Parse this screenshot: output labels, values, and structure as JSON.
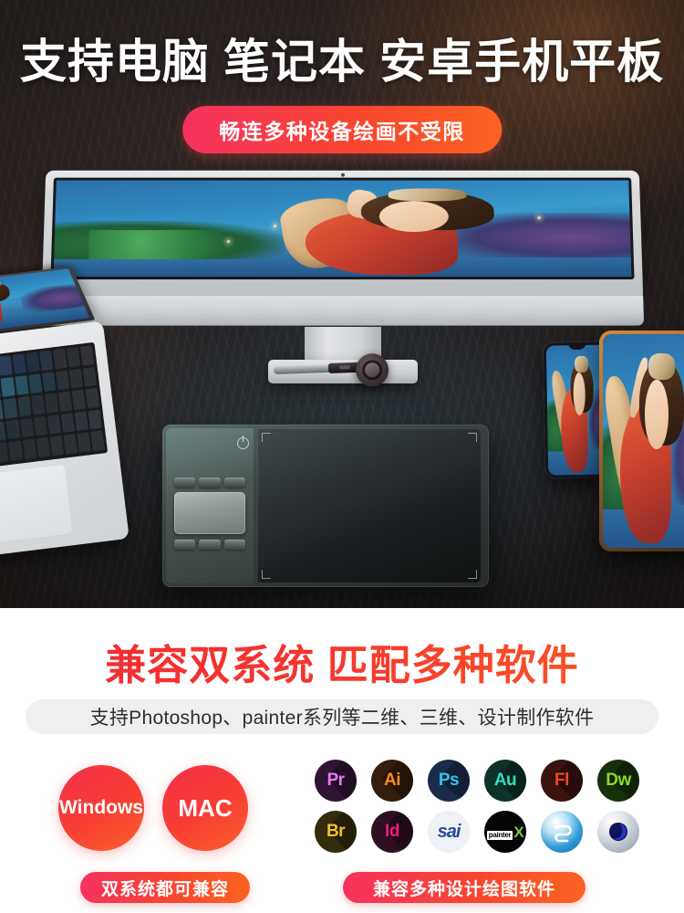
{
  "hero": {
    "title": "支持电脑 笔记本 安卓手机平板",
    "badge": "畅连多种设备绘画不受限"
  },
  "scene": {
    "monitor": "imac-desktop-monitor",
    "laptop": "macbook-laptop",
    "stylus": "stylus-pen",
    "pen_holder": "pen-holder",
    "drawing_tablet": "graphics-drawing-tablet",
    "phone": "android-smartphone",
    "tablet_device": "android-tablet",
    "artwork": "pipa-player-illustration"
  },
  "lower": {
    "title": "兼容双系统 匹配多种软件",
    "subtitle": "支持Photoshop、painter系列等二维、三维、设计制作软件"
  },
  "os": [
    {
      "name": "Windows",
      "label": "Windows"
    },
    {
      "name": "MAC",
      "label": "MAC"
    }
  ],
  "software": [
    {
      "label": "Pr",
      "name": "premiere-pro-icon",
      "bg": "#2f1533",
      "fg": "#ea77f7"
    },
    {
      "label": "Ai",
      "name": "illustrator-icon",
      "bg": "#331d0b",
      "fg": "#ff8a1e"
    },
    {
      "label": "Ps",
      "name": "photoshop-icon",
      "bg": "#1b2c4a",
      "fg": "#31c5f0"
    },
    {
      "label": "Au",
      "name": "audition-icon",
      "bg": "#0e3129",
      "fg": "#2ae0c0"
    },
    {
      "label": "Fl",
      "name": "flash-icon",
      "bg": "#3a1210",
      "fg": "#fa4616"
    },
    {
      "label": "Dw",
      "name": "dreamweaver-icon",
      "bg": "#17300c",
      "fg": "#8cdc1e"
    },
    {
      "label": "Br",
      "name": "bridge-icon",
      "bg": "#322c0c",
      "fg": "#f6c01e"
    },
    {
      "label": "Id",
      "name": "indesign-icon",
      "bg": "#2e0f21",
      "fg": "#f5197f"
    },
    {
      "label": "sai",
      "name": "paint-tool-sai-icon",
      "bg": "#eef1f6",
      "fg": "#2a4a96"
    },
    {
      "label": "painter X",
      "name": "corel-painter-x-icon",
      "bg": "#050505",
      "fg": "#ffffff"
    },
    {
      "label": "",
      "name": "3ds-max-icon",
      "bg": "#d6ecf7",
      "fg": "#1a84c8"
    },
    {
      "label": "",
      "name": "cinema-4d-icon",
      "bg": "#e3e6ea",
      "fg": "#141f6e"
    }
  ],
  "bottom_badges": [
    {
      "label": "双系统都可兼容",
      "name": "dual-os-compatible-badge"
    },
    {
      "label": "兼容多种设计绘图软件",
      "name": "software-compatible-badge"
    }
  ],
  "colors": {
    "accent_pink": "#f5325f",
    "accent_orange": "#fb6321",
    "headline_red": "#f02b34",
    "hero_bg": "#2b2321"
  }
}
